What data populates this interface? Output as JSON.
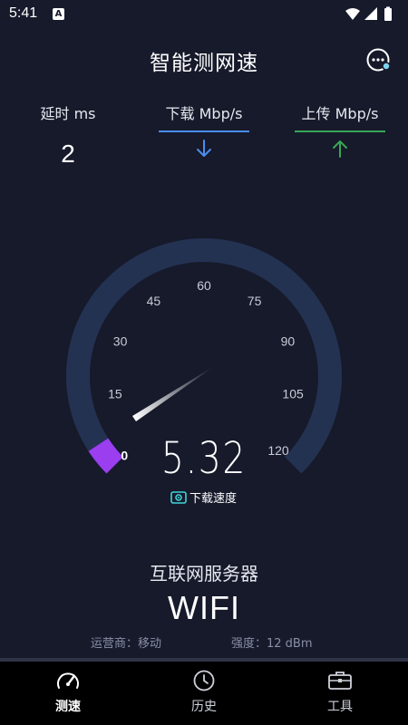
{
  "status_bar": {
    "time": "5:41",
    "notification_icon": "A"
  },
  "header": {
    "title": "智能测网速"
  },
  "metrics": {
    "latency": {
      "label": "延时 ms",
      "value": "2"
    },
    "download": {
      "label": "下载 Mbp/s",
      "color": "#4a8df0"
    },
    "upload": {
      "label": "上传 Mbp/s",
      "color": "#37a856"
    }
  },
  "gauge": {
    "ticks": [
      "0",
      "15",
      "30",
      "45",
      "60",
      "75",
      "90",
      "105",
      "120"
    ],
    "min": 0,
    "max": 120,
    "current_value": 5.32,
    "speed_display": "5.32",
    "speed_label": "下载速度",
    "arc_color": "#243252",
    "progress_color": "#9a3ef0"
  },
  "server": {
    "title": "互联网服务器",
    "network": "WIFI",
    "carrier": "运营商：移动",
    "strength": "强度：12 dBm"
  },
  "tabs": [
    {
      "label": "测速",
      "icon": "speedometer-icon"
    },
    {
      "label": "历史",
      "icon": "clock-icon"
    },
    {
      "label": "工具",
      "icon": "toolbox-icon"
    }
  ]
}
